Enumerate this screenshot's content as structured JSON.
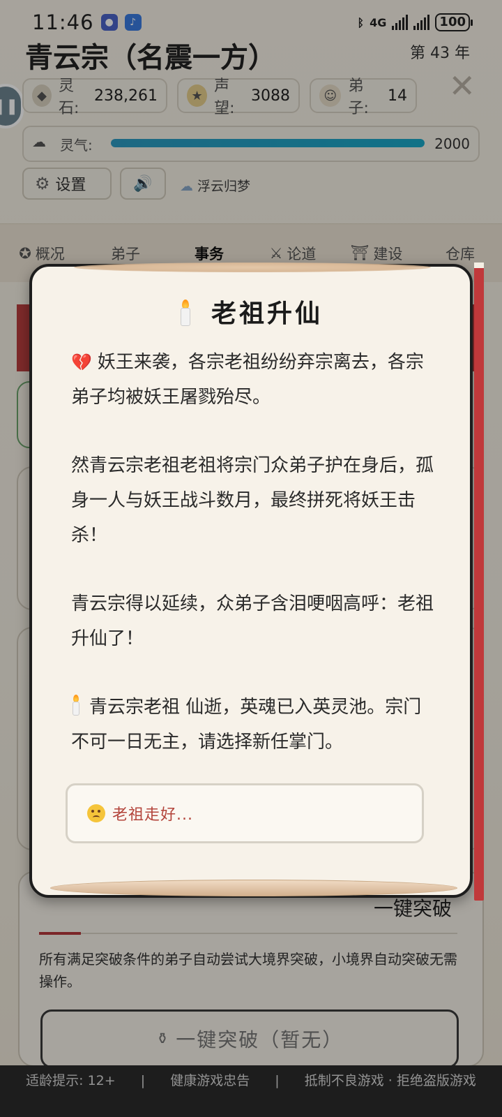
{
  "status_bar": {
    "time": "11:46",
    "battery": "100",
    "network": "4G"
  },
  "header": {
    "sect_title": "青云宗（名震一方）",
    "year": "第 43 年"
  },
  "resources": {
    "spirit_stone_label": "灵石:",
    "spirit_stone_value": "238,261",
    "prestige_label": "声望:",
    "prestige_value": "3088",
    "disciples_label": "弟子:",
    "disciples_value": "14",
    "qi_label": "灵气:",
    "qi_value": "2000",
    "qi_progress": 1.0
  },
  "toolbar": {
    "settings_label": "设置",
    "music_label": "浮云归梦"
  },
  "tabs": [
    {
      "label": "概况"
    },
    {
      "label": "弟子"
    },
    {
      "label": "事务"
    },
    {
      "label": "论道"
    },
    {
      "label": "建设"
    },
    {
      "label": "仓库"
    }
  ],
  "modal": {
    "title": "老祖升仙",
    "paragraph1": "妖王来袭，各宗老祖纷纷弃宗离去，各宗弟子均被妖王屠戮殆尽。",
    "paragraph2": "然青云宗老祖老祖将宗门众弟子护在身后，孤身一人与妖王战斗数月，最终拼死将妖王击杀！",
    "paragraph3": "青云宗得以延续，众弟子含泪哽咽高呼：老祖升仙了！",
    "paragraph4": "青云宗老祖 仙逝，英魂已入英灵池。宗门不可一日无主，请选择新任掌门。",
    "reply_button": "老祖走好..."
  },
  "breakthrough": {
    "title": "一键突破",
    "description": "所有满足突破条件的弟子自动尝试大境界突破，小境界自动突破无需操作。",
    "button_label": "一键突破（暂无）"
  },
  "notice_bar": {
    "age": "适龄提示: 12+",
    "health": "健康游戏忠告",
    "anti": "抵制不良游戏 · 拒绝盗版游戏"
  },
  "colors": {
    "accent_red": "#c0393b",
    "qi_bar": "#1aa8c8",
    "reply_text": "#b3443b"
  }
}
